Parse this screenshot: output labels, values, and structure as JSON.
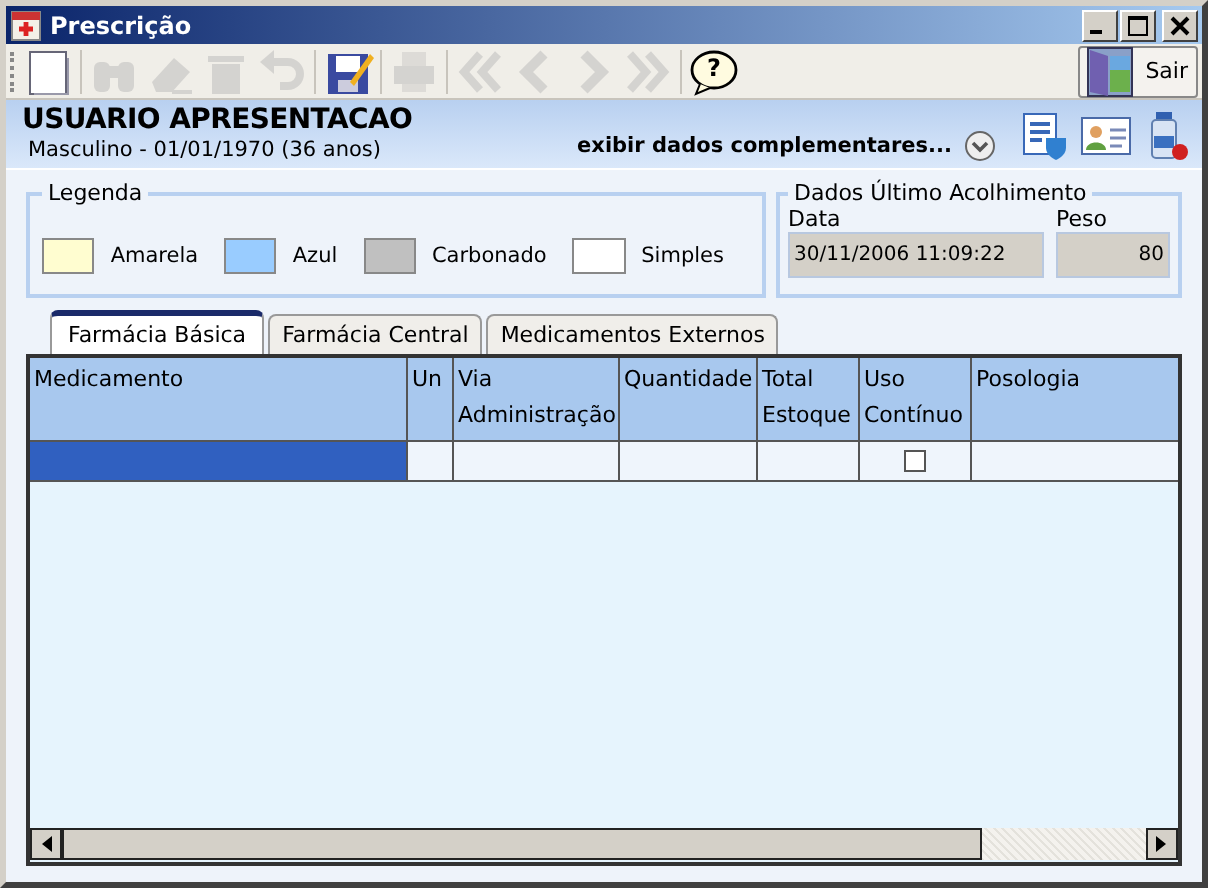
{
  "window": {
    "title": "Prescrição"
  },
  "toolbar": [
    {
      "kind": "new",
      "disabled": false
    },
    {
      "kind": "find",
      "disabled": true
    },
    {
      "kind": "erase",
      "disabled": true
    },
    {
      "kind": "delete",
      "disabled": true
    },
    {
      "kind": "undo",
      "disabled": true
    },
    {
      "kind": "save",
      "disabled": false
    },
    {
      "kind": "print",
      "disabled": true
    },
    {
      "kind": "first",
      "disabled": true
    },
    {
      "kind": "prev",
      "disabled": true
    },
    {
      "kind": "next",
      "disabled": true
    },
    {
      "kind": "last",
      "disabled": true
    },
    {
      "kind": "help",
      "disabled": false,
      "label": "?"
    }
  ],
  "exit_button": {
    "label": "Sair"
  },
  "patient": {
    "name": "USUARIO APRESENTACAO",
    "details": "Masculino - 01/01/1970 (36 anos)",
    "more_link": "exibir dados complementares..."
  },
  "legend": {
    "title": "Legenda",
    "items": [
      {
        "label": "Amarela",
        "color": "#fffdd0"
      },
      {
        "label": "Azul",
        "color": "#99ccff"
      },
      {
        "label": "Carbonado",
        "color": "#c0c0c0"
      },
      {
        "label": "Simples",
        "color": "#ffffff"
      }
    ]
  },
  "last_intake": {
    "title": "Dados Último Acolhimento",
    "fields": [
      {
        "label": "Data",
        "value": "30/11/2006 11:09:22"
      },
      {
        "label": "Peso",
        "value": "80"
      }
    ]
  },
  "tabs": [
    {
      "label": "Farmácia Básica",
      "selected": true
    },
    {
      "label": "Farmácia Central",
      "selected": false
    },
    {
      "label": "Medicamentos Externos",
      "selected": false
    }
  ],
  "table": {
    "columns": [
      "Medicamento",
      "Un",
      "Via Administração",
      "Quantidade",
      "Total Estoque",
      "Uso Contínuo",
      "Posologia"
    ],
    "rows": [
      {
        "selected": true,
        "uso_continuo": false
      }
    ]
  }
}
